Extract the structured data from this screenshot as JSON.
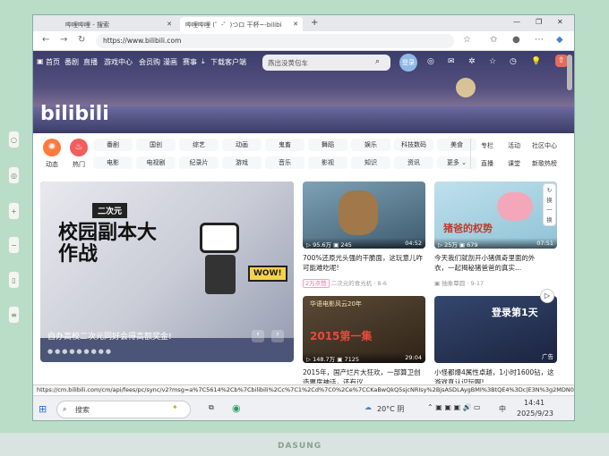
{
  "device": {
    "brand": "DASUNG"
  },
  "browser": {
    "tabs": [
      {
        "label": "哔哩哔哩 - 搜索"
      },
      {
        "label": "哔哩哔哩 (゜-゜)つロ 干杯~-bilibi"
      }
    ],
    "new_tab": "+",
    "url": "https://www.bilibili.com",
    "status_url": "https://cm.bilibili.com/cm/api/fees/pc/sync/v2?msg=a%7C5614%2Cb%7Cbilibili%2Cc%7C1%2Cd%7C0%2Ce%7CCKaBwQkQ5sjcNRIsy%2BjsASDLAygBMI%3BtQE4%3Dc|E3N%3g2MDN0ODMw..."
  },
  "header": {
    "nav": [
      "首页",
      "番剧",
      "直播",
      "游戏中心",
      "会员购",
      "漫画",
      "赛事",
      "下载客户端"
    ],
    "search_placeholder": "燕出没黄包车",
    "login": "登录",
    "logo": "bilibili"
  },
  "channels": {
    "dynamic": "动态",
    "hot": "热门",
    "row1": [
      "番剧",
      "国创",
      "综艺",
      "动画",
      "鬼畜",
      "舞蹈",
      "娱乐",
      "科技数码",
      "美食"
    ],
    "row2": [
      "电影",
      "电视剧",
      "纪录片",
      "游戏",
      "音乐",
      "影视",
      "知识",
      "资讯",
      "更多"
    ],
    "right1": [
      "专栏",
      "活动",
      "社区中心"
    ],
    "right2": [
      "直播",
      "课堂",
      "新歌热榜"
    ]
  },
  "carousel": {
    "caption": "自办高校二次元同好会得高额奖金!",
    "art_text": "校园副本大作战",
    "art_badge": "二次元",
    "wow": "WOW!"
  },
  "videos": [
    {
      "views": "95.6万",
      "danmaku": "245",
      "duration": "04:52",
      "title": "700%还原光头强的干脆面，这玩意儿咋可能难吃呢!",
      "badge": "2万点赞",
      "uploader": "二次元的食光机",
      "date": "8-6"
    },
    {
      "views": "25万",
      "danmaku": "679",
      "duration": "07:51",
      "title": "今天我们就剖开小猪佩奇里面的外衣，一起揭秘猪爸爸的真实...",
      "badge": "",
      "uploader": "抽象覃圆",
      "date": "9-17",
      "thumb_text": "猪爸的权势"
    },
    {
      "views": "148.7万",
      "danmaku": "7125",
      "duration": "29:04",
      "title": "2015年，国产烂片大狂欢，一部算卫创造票房神话，还有议...",
      "badge": "",
      "uploader": "",
      "date": "",
      "thumb_text": "华语电影风云20年",
      "thumb_year": "2015第一集"
    },
    {
      "views": "",
      "danmaku": "",
      "duration": "",
      "title": "小怪都爆4属性卓越，1小时1600钻，这游戏真认识玩啊!",
      "badge": "",
      "uploader": "",
      "date": "",
      "thumb_text": "登录第1天",
      "ad": "广告"
    }
  ],
  "refresh": [
    "换",
    "一",
    "换"
  ],
  "taskbar": {
    "search": "搜索",
    "weather": "20°C 阴",
    "ime": "中",
    "time": "14:41",
    "date": "2025/9/23"
  },
  "colors": {
    "accent": "#fb7299",
    "blue": "#00aeec",
    "banner": "#3b3d6b"
  }
}
